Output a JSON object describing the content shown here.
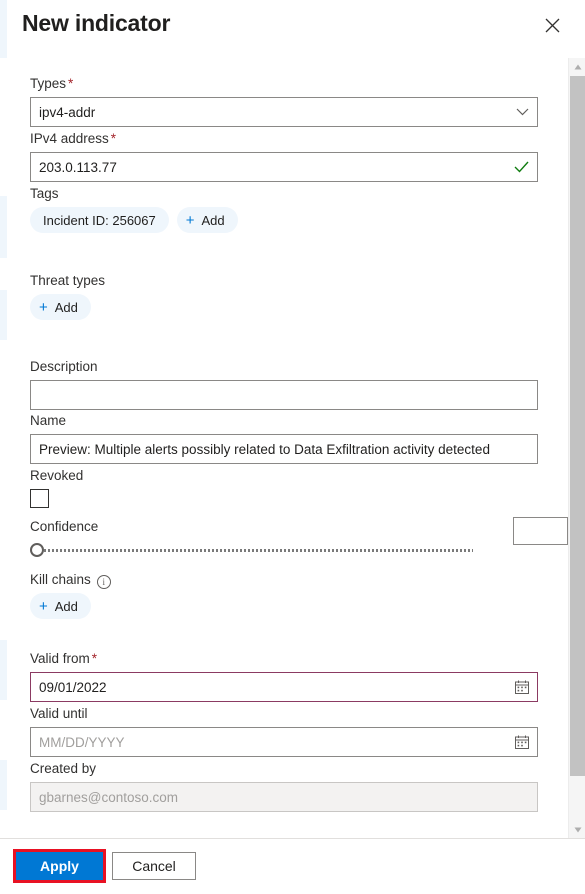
{
  "panel": {
    "title": "New indicator",
    "close_icon": "close-icon"
  },
  "fields": {
    "types": {
      "label": "Types",
      "required_mark": "*",
      "value": "ipv4-addr",
      "chevron_icon": "chevron-down-icon"
    },
    "ipv4": {
      "label": "IPv4 address",
      "required_mark": "*",
      "value": "203.0.113.77",
      "validation_icon": "check-icon",
      "validation_color": "#107c10"
    },
    "tags": {
      "label": "Tags",
      "items": [
        "Incident ID: 256067"
      ],
      "add_label": "Add",
      "add_icon": "plus-icon"
    },
    "threat_types": {
      "label": "Threat types",
      "add_label": "Add",
      "add_icon": "plus-icon"
    },
    "description": {
      "label": "Description",
      "value": "",
      "placeholder": ""
    },
    "name": {
      "label": "Name",
      "value": "Preview: Multiple alerts possibly related to Data Exfiltration activity detected"
    },
    "revoked": {
      "label": "Revoked",
      "checked": false
    },
    "confidence": {
      "label": "Confidence",
      "value": "",
      "slider_position_percent": 0,
      "min": 0,
      "max": 100
    },
    "kill_chains": {
      "label": "Kill chains",
      "info_icon": "info-icon",
      "info_glyph": "i",
      "add_label": "Add",
      "add_icon": "plus-icon"
    },
    "valid_from": {
      "label": "Valid from",
      "required_mark": "*",
      "value": "09/01/2022",
      "calendar_icon": "calendar-icon",
      "border_color": "#8b3a62"
    },
    "valid_until": {
      "label": "Valid until",
      "value": "",
      "placeholder": "MM/DD/YYYY",
      "calendar_icon": "calendar-icon"
    },
    "created_by": {
      "label": "Created by",
      "value": "gbarnes@contoso.com",
      "disabled": true
    }
  },
  "footer": {
    "apply_label": "Apply",
    "cancel_label": "Cancel",
    "apply_color": "#0078d4",
    "highlight_color": "#e81123"
  },
  "scrollbar": {
    "up_icon": "caret-up-icon",
    "down_icon": "caret-down-icon"
  }
}
